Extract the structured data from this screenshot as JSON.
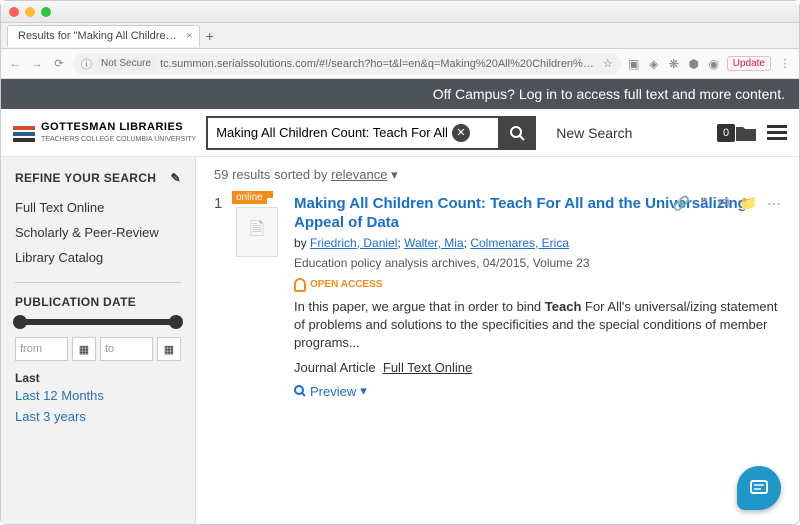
{
  "browser": {
    "tab_title": "Results for \"Making All Childre…",
    "not_secure": "Not Secure",
    "url": "tc.summon.serialssolutions.com/#!/search?ho=t&l=en&q=Making%20All%20Children%20Count:%20Teach%20For%20All%20a...",
    "update": "Update"
  },
  "banner": "Off Campus? Log in to access full text and more content.",
  "logo": {
    "line1": "GOTTESMAN LIBRARIES",
    "line2": "TEACHERS COLLEGE COLUMBIA UNIVERSITY"
  },
  "search": {
    "value": "Making All Children Count: Teach For All",
    "new_search": "New Search"
  },
  "folder_count": "0",
  "sort": {
    "count": "59",
    "label": "results sorted by",
    "by": "relevance"
  },
  "sidebar": {
    "refine": "REFINE YOUR SEARCH",
    "opts": [
      "Full Text Online",
      "Scholarly & Peer-Review",
      "Library Catalog"
    ],
    "pubdate": "PUBLICATION DATE",
    "from": "from",
    "to": "to",
    "last": "Last",
    "last_links": [
      "Last 12 Months",
      "Last 3 years"
    ]
  },
  "result": {
    "num": "1",
    "online": "online",
    "title": "Making All Children Count: Teach For All and the Universalizing Appeal of Data",
    "by": "by ",
    "authors": [
      "Friedrich, Daniel",
      "Walter, Mia",
      "Colmenares, Erica"
    ],
    "source": "Education policy analysis archives, 04/2015, Volume 23",
    "open_access": "OPEN ACCESS",
    "abstract_pre": "In this paper, we argue that in order to bind ",
    "abstract_bold": "Teach",
    "abstract_post": " For All's universal/izing statement of problems and solutions to the specificities and the special conditions of member programs...",
    "type": "Journal Article",
    "full_text": "Full Text Online",
    "preview": "Preview"
  }
}
